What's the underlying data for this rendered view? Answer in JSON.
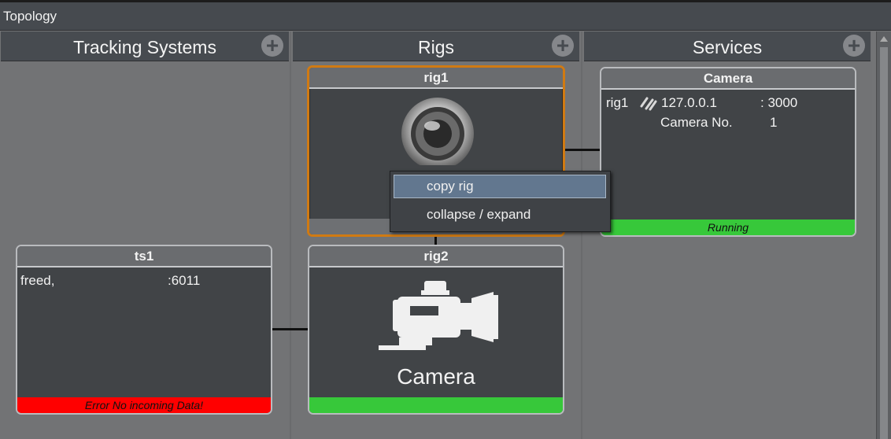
{
  "window": {
    "title": "Topology"
  },
  "columns": [
    {
      "title": "Tracking Systems",
      "add_icon": "+"
    },
    {
      "title": "Rigs",
      "add_icon": "+"
    },
    {
      "title": "Services",
      "add_icon": "+"
    }
  ],
  "nodes": {
    "rig1": {
      "title": "rig1",
      "icon": "camera-lens-icon"
    },
    "rig2": {
      "title": "rig2",
      "icon": "camera-icon",
      "icon_label": "Camera",
      "status_color": "#37c83a"
    },
    "ts1": {
      "title": "ts1",
      "protocol": "freed,",
      "port": ":6011",
      "status": "Error No incoming Data!",
      "status_color": "#ff0000"
    },
    "camera": {
      "title": "Camera",
      "rig": "rig1",
      "ip": "127.0.0.1",
      "port": ": 3000",
      "camera_no_label": "Camera No.",
      "camera_no_value": "1",
      "status": "Running",
      "status_color": "#37c83a",
      "link_icon": "broken-link-icon"
    }
  },
  "context_menu": {
    "items": [
      {
        "label": "copy rig",
        "highlighted": true
      },
      {
        "label": "collapse / expand",
        "highlighted": false
      }
    ]
  },
  "colors": {
    "selection": "#d07a12",
    "header": "#474b50",
    "background": "#737476"
  }
}
